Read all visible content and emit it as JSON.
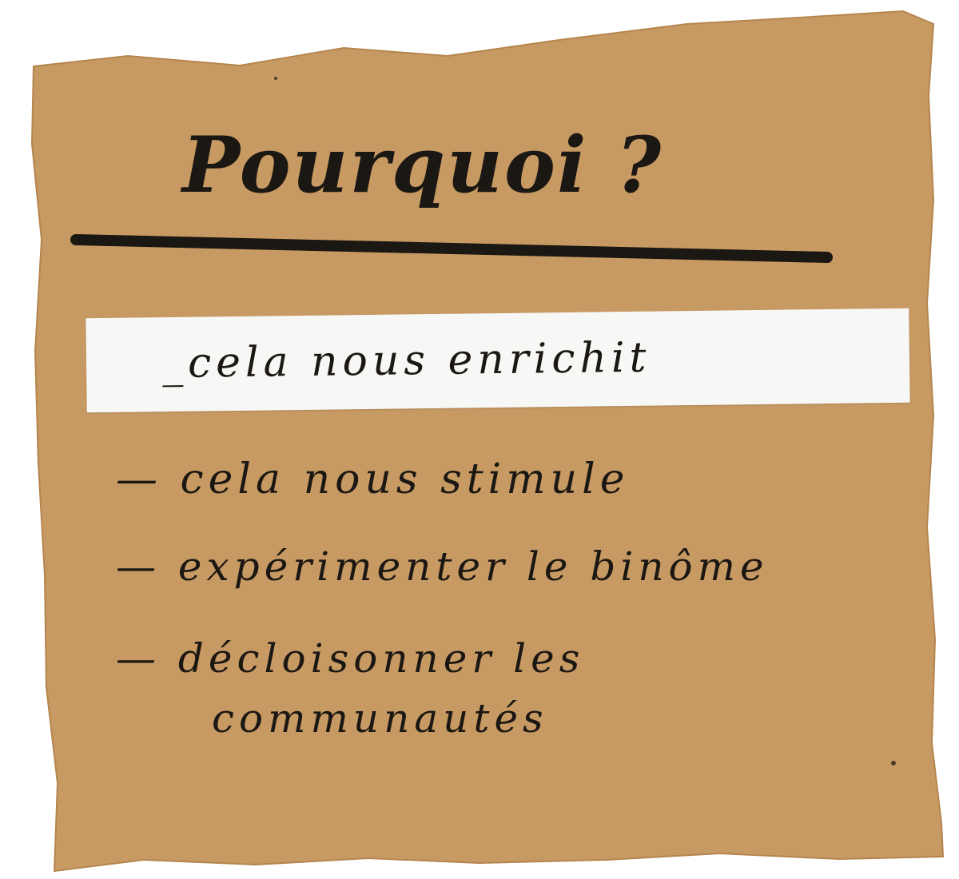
{
  "colors": {
    "kraft_paper": "#c89a63",
    "label_strip": "#f7f7f5",
    "marker_ink": "#1b1712",
    "background": "#ffffff"
  },
  "note": {
    "title": "Pourquoi ?",
    "highlighted_item": "_cela nous enrichit",
    "items": [
      "— cela nous stimule",
      "— expérimenter le binôme",
      "— décloisonner les",
      "communautés"
    ]
  }
}
